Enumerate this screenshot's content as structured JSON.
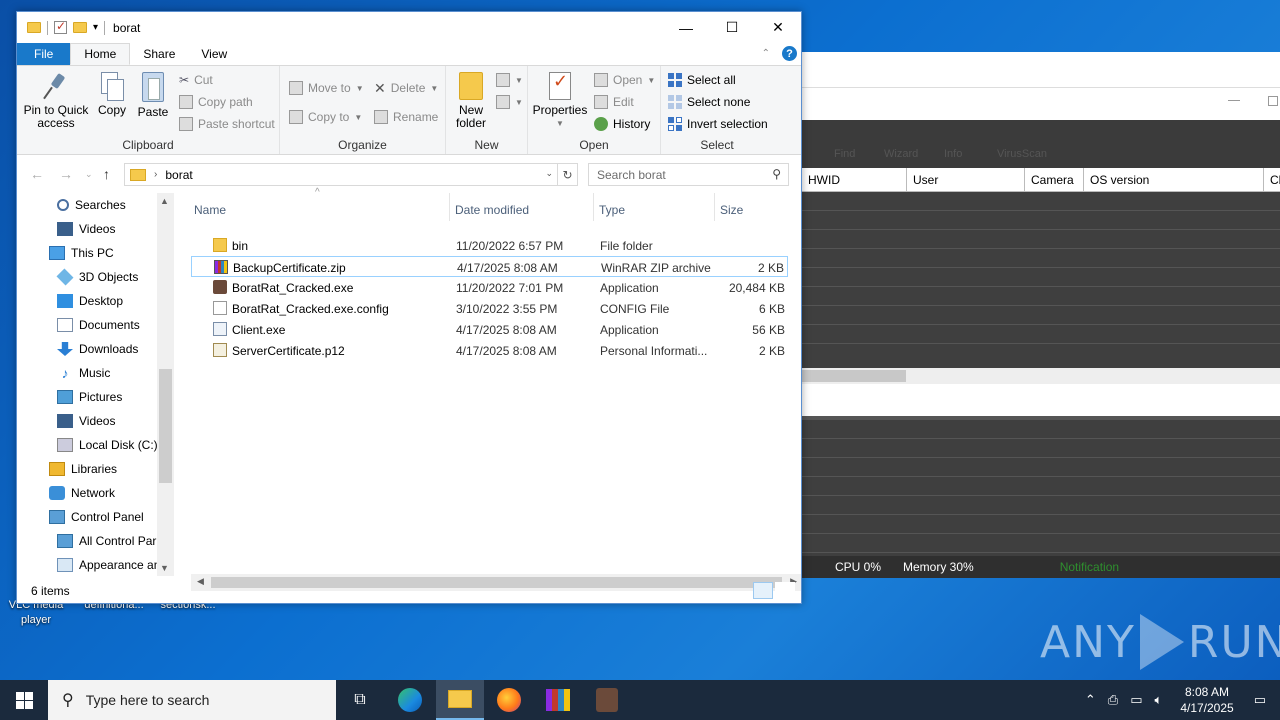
{
  "desktop": {
    "icons": [
      "VLC media player",
      "definitiona...",
      "sectionsk..."
    ]
  },
  "watermark": {
    "text_left": "ANY",
    "text_right": "RUN"
  },
  "bg_app": {
    "toolbar_items": [
      "Find",
      "Wizard",
      "Info",
      "VirusScan"
    ],
    "columns": [
      "HWID",
      "User",
      "Camera",
      "OS version",
      "Ch"
    ],
    "status": {
      "cpu": "CPU 0%",
      "memory": "Memory 30%",
      "notification": "Notification"
    }
  },
  "explorer": {
    "title": "borat",
    "window_controls": {
      "minimize": "—",
      "maximize": "☐",
      "close": "✕"
    },
    "tabs": {
      "file": "File",
      "home": "Home",
      "share": "Share",
      "view": "View"
    },
    "ribbon": {
      "clipboard": {
        "label": "Clipboard",
        "pin": "Pin to Quick access",
        "copy": "Copy",
        "paste": "Paste",
        "cut": "Cut",
        "copy_path": "Copy path",
        "paste_shortcut": "Paste shortcut"
      },
      "organize": {
        "label": "Organize",
        "move_to": "Move to",
        "copy_to": "Copy to",
        "delete": "Delete",
        "rename": "Rename"
      },
      "new": {
        "label": "New",
        "new_folder": "New folder"
      },
      "open": {
        "label": "Open",
        "properties": "Properties",
        "open": "Open",
        "edit": "Edit",
        "history": "History"
      },
      "select": {
        "label": "Select",
        "select_all": "Select all",
        "select_none": "Select none",
        "invert": "Invert selection"
      }
    },
    "address": {
      "path": "borat",
      "search_placeholder": "Search borat"
    },
    "nav": [
      {
        "label": "Searches",
        "icon": "search-icon",
        "indent": 1
      },
      {
        "label": "Videos",
        "icon": "video-icon",
        "indent": 1
      },
      {
        "label": "This PC",
        "icon": "pc-icon",
        "indent": 0
      },
      {
        "label": "3D Objects",
        "icon": "cube-icon",
        "indent": 1
      },
      {
        "label": "Desktop",
        "icon": "desktop-icon",
        "indent": 1
      },
      {
        "label": "Documents",
        "icon": "document-icon",
        "indent": 1
      },
      {
        "label": "Downloads",
        "icon": "download-icon",
        "indent": 1
      },
      {
        "label": "Music",
        "icon": "music-icon",
        "indent": 1
      },
      {
        "label": "Pictures",
        "icon": "picture-icon",
        "indent": 1
      },
      {
        "label": "Videos",
        "icon": "video-icon",
        "indent": 1
      },
      {
        "label": "Local Disk (C:)",
        "icon": "disk-icon",
        "indent": 1
      },
      {
        "label": "Libraries",
        "icon": "library-icon",
        "indent": 0
      },
      {
        "label": "Network",
        "icon": "network-icon",
        "indent": 0
      },
      {
        "label": "Control Panel",
        "icon": "control-panel-icon",
        "indent": 0
      },
      {
        "label": "All Control Par",
        "icon": "control-panel-icon",
        "indent": 1
      },
      {
        "label": "Appearance an",
        "icon": "appearance-icon",
        "indent": 1
      }
    ],
    "columns": {
      "name": "Name",
      "date": "Date modified",
      "type": "Type",
      "size": "Size"
    },
    "files": [
      {
        "name": "bin",
        "date": "11/20/2022 6:57 PM",
        "type": "File folder",
        "size": "",
        "icon": "folder-icon"
      },
      {
        "name": "BackupCertificate.zip",
        "date": "4/17/2025 8:08 AM",
        "type": "WinRAR ZIP archive",
        "size": "2 KB",
        "icon": "winrar-icon",
        "selected": true
      },
      {
        "name": "BoratRat_Cracked.exe",
        "date": "11/20/2022 7:01 PM",
        "type": "Application",
        "size": "20,484 KB",
        "icon": "borat-icon"
      },
      {
        "name": "BoratRat_Cracked.exe.config",
        "date": "3/10/2022 3:55 PM",
        "type": "CONFIG File",
        "size": "6 KB",
        "icon": "config-file-icon"
      },
      {
        "name": "Client.exe",
        "date": "4/17/2025 8:08 AM",
        "type": "Application",
        "size": "56 KB",
        "icon": "application-icon"
      },
      {
        "name": "ServerCertificate.p12",
        "date": "4/17/2025 8:08 AM",
        "type": "Personal Informati...",
        "size": "2 KB",
        "icon": "certificate-icon"
      }
    ],
    "status": {
      "item_count": "6 items"
    }
  },
  "taskbar": {
    "search_placeholder": "Type here to search",
    "time": "8:08 AM",
    "date": "4/17/2025"
  }
}
